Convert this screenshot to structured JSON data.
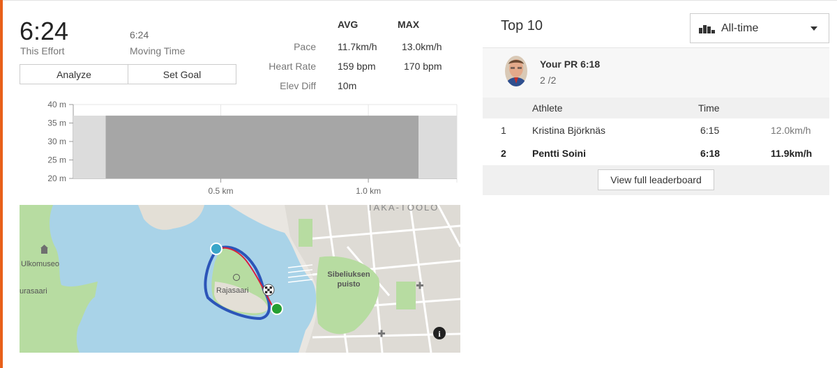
{
  "effort": {
    "time": "6:24",
    "label": "This Effort",
    "moving_time": "6:24",
    "moving_label": "Moving Time"
  },
  "actions": {
    "analyze": "Analyze",
    "set_goal": "Set Goal"
  },
  "stats": {
    "avg_header": "AVG",
    "max_header": "MAX",
    "rows": [
      {
        "label": "Pace",
        "avg": "11.7km/h",
        "max": "13.0km/h"
      },
      {
        "label": "Heart Rate",
        "avg": "159 bpm",
        "max": "170 bpm"
      },
      {
        "label": "Elev Diff",
        "avg": "10m",
        "max": ""
      }
    ]
  },
  "chart_data": {
    "type": "area",
    "y_ticks": [
      "40 m",
      "35 m",
      "30 m",
      "25 m",
      "20 m"
    ],
    "x_ticks": [
      "0.5 km",
      "1.0 km"
    ],
    "ylim": [
      20,
      40
    ],
    "x_km": [
      0,
      1.3
    ],
    "segment_km": [
      0.11,
      1.17
    ],
    "elevation_m": 37
  },
  "map": {
    "labels": {
      "taka_toolo": "TAKA-TÖÖLÖ",
      "ulkomuseo": "Ulkomuseo",
      "urasaari": "urasaari",
      "rajasaari": "Rajasaari",
      "sibeliuksen_1": "Sibeliuksen",
      "sibeliuksen_2": "puisto"
    },
    "colors": {
      "water": "#a9d3e8",
      "park": "#b7dca1",
      "land": "#e9e6e1",
      "route_blue": "#2c55b8",
      "route_red": "#d9213a",
      "start": "#3aa6c9",
      "finish": "#25a032"
    }
  },
  "leaderboard": {
    "title": "Top 10",
    "filter": "All-time",
    "pr": {
      "title": "Your PR 6:18",
      "rank": "2 /2"
    },
    "columns": {
      "athlete": "Athlete",
      "time": "Time"
    },
    "rows": [
      {
        "rank": "1",
        "athlete": "Kristina Björknäs",
        "time": "6:15",
        "speed": "12.0km/h",
        "bold": false
      },
      {
        "rank": "2",
        "athlete": "Pentti Soini",
        "time": "6:18",
        "speed": "11.9km/h",
        "bold": true
      }
    ],
    "view_full": "View full leaderboard"
  },
  "colors": {
    "accent": "#e8601a"
  }
}
